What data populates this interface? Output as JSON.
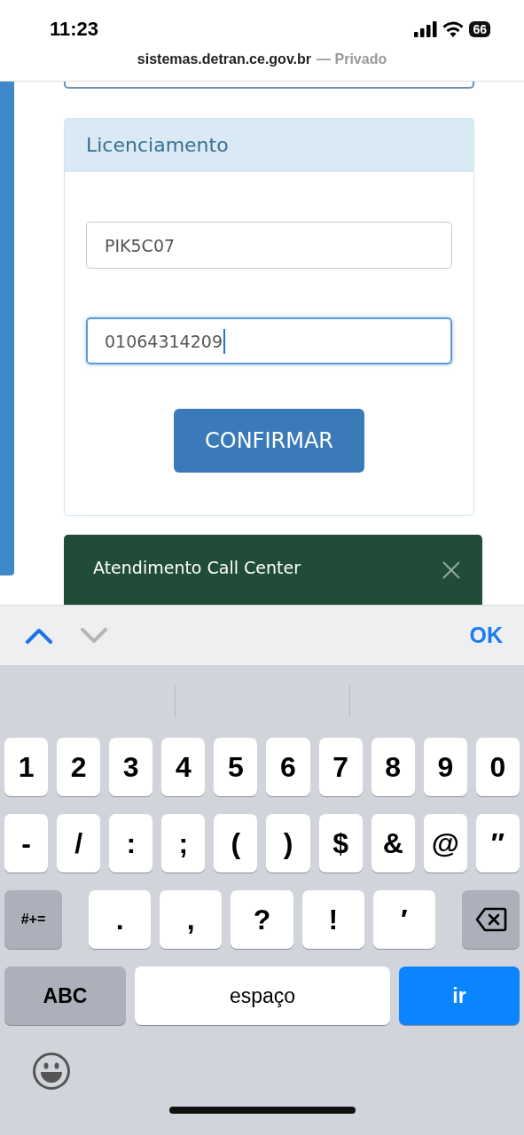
{
  "status_bar": {
    "time": "11:23",
    "battery": "66"
  },
  "address_bar": {
    "domain": "sistemas.detran.ce.gov.br",
    "suffix": "— Privado"
  },
  "panel": {
    "title": "Licenciamento",
    "fields": [
      {
        "value": "PIK5C07",
        "focused": false
      },
      {
        "value": "01064314209",
        "focused": true
      }
    ],
    "button": "CONFIRMAR"
  },
  "chat_bar": {
    "title": "Atendimento Call Center"
  },
  "accessory_bar": {
    "previous_disabled": false,
    "next_disabled": true,
    "done": "OK"
  },
  "keyboard": {
    "key_rows": [
      [
        {
          "label": "1",
          "kind": "char"
        },
        {
          "label": "2",
          "kind": "char"
        },
        {
          "label": "3",
          "kind": "char"
        },
        {
          "label": "4",
          "kind": "char"
        },
        {
          "label": "5",
          "kind": "char"
        },
        {
          "label": "6",
          "kind": "char"
        },
        {
          "label": "7",
          "kind": "char"
        },
        {
          "label": "8",
          "kind": "char"
        },
        {
          "label": "9",
          "kind": "char"
        },
        {
          "label": "0",
          "kind": "char"
        }
      ],
      [
        {
          "label": "-",
          "kind": "char"
        },
        {
          "label": "/",
          "kind": "char"
        },
        {
          "label": ":",
          "kind": "char"
        },
        {
          "label": ";",
          "kind": "char"
        },
        {
          "label": "(",
          "kind": "char"
        },
        {
          "label": ")",
          "kind": "char"
        },
        {
          "label": "$",
          "kind": "char"
        },
        {
          "label": "&",
          "kind": "char"
        },
        {
          "label": "@",
          "kind": "char"
        },
        {
          "label": "″",
          "kind": "char"
        }
      ],
      [
        {
          "label": "#+=",
          "kind": "function"
        },
        {
          "label": ".",
          "kind": "wide"
        },
        {
          "label": ",",
          "kind": "wide"
        },
        {
          "label": "?",
          "kind": "wide"
        },
        {
          "label": "!",
          "kind": "wide"
        },
        {
          "label": "′",
          "kind": "wide"
        },
        {
          "kind": "backspace"
        }
      ]
    ],
    "bottom_keys": [
      {
        "label": "ABC",
        "kind": "mode"
      },
      {
        "label": "espaço",
        "kind": "space"
      },
      {
        "label": "ir",
        "kind": "primary"
      }
    ]
  }
}
